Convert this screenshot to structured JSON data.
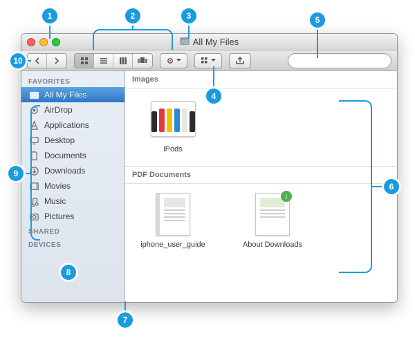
{
  "window": {
    "title": "All My Files"
  },
  "sidebar": {
    "sections": {
      "favorites": "FAVORITES",
      "shared": "SHARED",
      "devices": "DEVICES"
    },
    "items": [
      {
        "label": "All My Files"
      },
      {
        "label": "AirDrop"
      },
      {
        "label": "Applications"
      },
      {
        "label": "Desktop"
      },
      {
        "label": "Documents"
      },
      {
        "label": "Downloads"
      },
      {
        "label": "Movies"
      },
      {
        "label": "Music"
      },
      {
        "label": "Pictures"
      }
    ]
  },
  "content": {
    "groups": [
      {
        "title": "Images",
        "files": [
          {
            "name": "iPods"
          }
        ]
      },
      {
        "title": "PDF Documents",
        "files": [
          {
            "name": "iphone_user_guide"
          },
          {
            "name": "About Downloads"
          }
        ]
      }
    ]
  },
  "search": {
    "placeholder": ""
  },
  "callouts": [
    "1",
    "2",
    "3",
    "4",
    "5",
    "6",
    "7",
    "8",
    "9",
    "10"
  ]
}
